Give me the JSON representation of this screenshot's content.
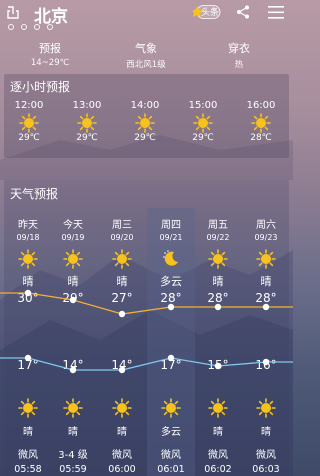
{
  "header": {
    "city": "北京",
    "news_label": "头条",
    "page_dots": 4
  },
  "summary": [
    {
      "label": "预报",
      "value": "14~29℃"
    },
    {
      "label": "气象",
      "value": "西北风1级"
    },
    {
      "label": "穿衣",
      "value": "热"
    }
  ],
  "hourly": {
    "title": "逐小时预报",
    "items": [
      {
        "time": "12:00",
        "temp": "29℃",
        "icon": "sun-icon"
      },
      {
        "time": "13:00",
        "temp": "29℃",
        "icon": "sun-icon"
      },
      {
        "time": "14:00",
        "temp": "29℃",
        "icon": "sun-icon"
      },
      {
        "time": "15:00",
        "temp": "29℃",
        "icon": "sun-icon"
      },
      {
        "time": "16:00",
        "temp": "28℃",
        "icon": "sun-icon"
      }
    ]
  },
  "daily": {
    "title": "天气预报",
    "days": [
      {
        "name": "昨天",
        "date": "09/18",
        "day_icon": "sun-icon",
        "day_cond": "晴",
        "high": 30,
        "high_label": "30°",
        "low": 17,
        "low_label": "17°",
        "night_icon": "sun-icon",
        "night_cond": "晴",
        "wind": "微风",
        "sunset": "05:58"
      },
      {
        "name": "今天",
        "date": "09/19",
        "day_icon": "sun-icon",
        "day_cond": "晴",
        "high": 29,
        "high_label": "29°",
        "low": 14,
        "low_label": "14°",
        "night_icon": "sun-icon",
        "night_cond": "晴",
        "wind": "3-4 级",
        "sunset": "05:59"
      },
      {
        "name": "周三",
        "date": "09/20",
        "day_icon": "sun-icon",
        "day_cond": "晴",
        "high": 27,
        "high_label": "27°",
        "low": 14,
        "low_label": "14°",
        "night_icon": "sun-icon",
        "night_cond": "晴",
        "wind": "微风",
        "sunset": "06:00"
      },
      {
        "name": "周四",
        "date": "09/21",
        "day_icon": "moon-icon",
        "day_cond": "多云",
        "high": 28,
        "high_label": "28°",
        "low": 17,
        "low_label": "17°",
        "night_icon": "sun-icon",
        "night_cond": "多云",
        "wind": "微风",
        "sunset": "06:01"
      },
      {
        "name": "周五",
        "date": "09/22",
        "day_icon": "sun-icon",
        "day_cond": "晴",
        "high": 28,
        "high_label": "28°",
        "low": 15,
        "low_label": "15°",
        "night_icon": "sun-icon",
        "night_cond": "晴",
        "wind": "微风",
        "sunset": "06:02"
      },
      {
        "name": "周六",
        "date": "09/23",
        "day_icon": "sun-icon",
        "day_cond": "晴",
        "high": 28,
        "high_label": "28°",
        "low": 16,
        "low_label": "16°",
        "night_icon": "sun-icon",
        "night_cond": "晴",
        "wind": "微风",
        "sunset": "06:03"
      }
    ]
  },
  "colors": {
    "sun": "#f7c21e",
    "high_line": "#f2b135",
    "low_line": "#7fc9f0"
  }
}
